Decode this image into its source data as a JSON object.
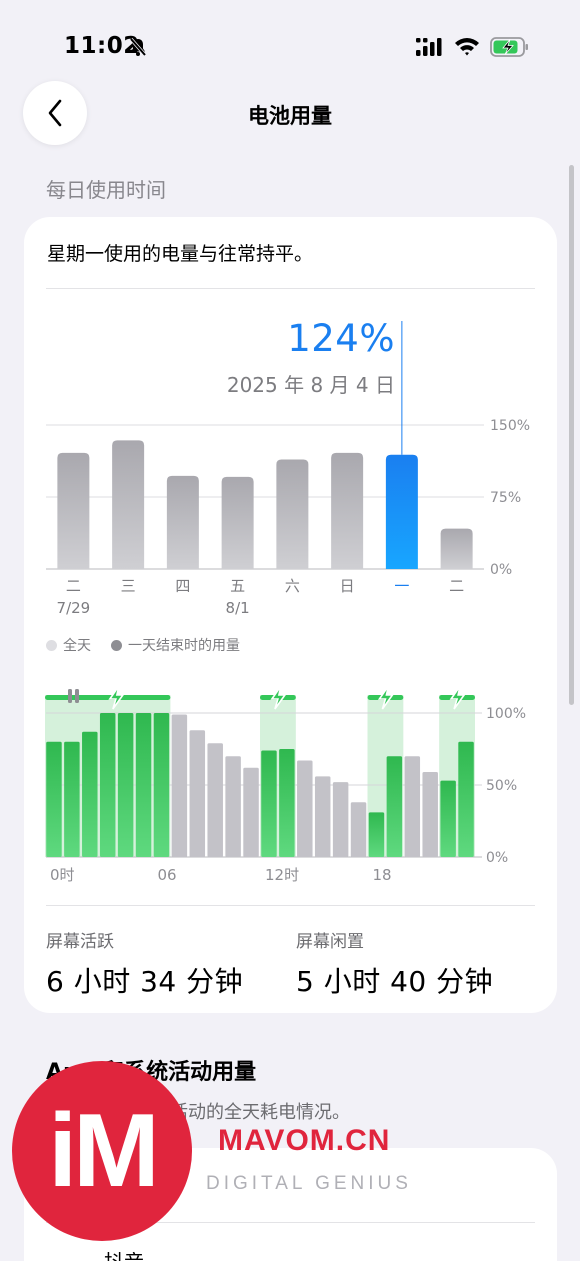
{
  "status_bar": {
    "time": "11:02"
  },
  "nav": {
    "title": "电池用量"
  },
  "daily": {
    "section_header": "每日使用时间",
    "summary": "星期一使用的电量与往常持平。",
    "selected_value": "124%",
    "selected_date": "2025 年 8 月 4 日"
  },
  "legend": {
    "all_day": "全天",
    "end_of_day": "一天结束时的用量"
  },
  "stats": {
    "active_label": "屏幕活跃",
    "active_value": "6 小时 34 分钟",
    "idle_label": "屏幕闲置",
    "idle_value": "5 小时 40 分钟"
  },
  "section2": {
    "title": "App 和系统活动用量",
    "subtitle": "系统活动的全天耗电情况。",
    "first_app": "抖音"
  },
  "watermark": {
    "logo": "iM",
    "site": "MAVOM.CN",
    "tagline": "DIGITAL GENIUS"
  },
  "colors": {
    "accent": "#1a7ff0",
    "gray_bar": "#c3c2c8",
    "green": "#34c759",
    "charge_band": "#d5f1db",
    "watermark_red": "#e0253d"
  },
  "chart_data": [
    {
      "type": "bar",
      "title": "",
      "categories": [
        "二",
        "三",
        "四",
        "五",
        "六",
        "日",
        "一",
        "二"
      ],
      "sub_labels": [
        "7/29",
        "",
        "",
        "8/1",
        "",
        "",
        "",
        ""
      ],
      "values": [
        121,
        134,
        97,
        96,
        114,
        121,
        119,
        42
      ],
      "selected_index": 6,
      "y_ticks": [
        "0%",
        "75%",
        "150%"
      ],
      "ylim": [
        0,
        150
      ],
      "grid": true
    },
    {
      "type": "bar",
      "title": "",
      "x_tick_labels": [
        "0时",
        "06",
        "12时",
        "18"
      ],
      "y_ticks": [
        "0%",
        "50%",
        "100%"
      ],
      "ylim": [
        0,
        100
      ],
      "values": [
        80,
        80,
        87,
        100,
        100,
        100,
        100,
        99,
        88,
        79,
        70,
        62,
        74,
        75,
        67,
        56,
        52,
        38,
        31,
        70,
        70,
        59,
        53,
        80
      ],
      "charging": [
        true,
        true,
        true,
        true,
        true,
        true,
        true,
        false,
        false,
        false,
        false,
        false,
        true,
        true,
        false,
        false,
        false,
        false,
        true,
        true,
        false,
        false,
        true,
        true
      ],
      "charging_ranges": [
        [
          0,
          7
        ],
        [
          12,
          14
        ],
        [
          18,
          20
        ],
        [
          22,
          24
        ]
      ],
      "grid": true
    }
  ]
}
